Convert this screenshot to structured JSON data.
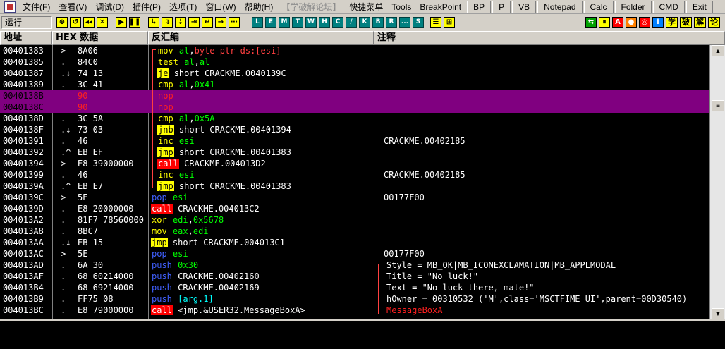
{
  "menu": {
    "items": [
      "文件(F)",
      "查看(V)",
      "调试(D)",
      "插件(P)",
      "选项(T)",
      "窗口(W)",
      "帮助(H)"
    ],
    "disabled_item": "【学破解论坛】",
    "quick_menu": "快捷菜单",
    "plain_items": [
      "Tools",
      "BreakPoint"
    ],
    "buttons": [
      "BP",
      "P",
      "VB",
      "Notepad",
      "Calc",
      "Folder",
      "CMD",
      "Exit"
    ]
  },
  "toolbar": {
    "status": "运行",
    "run_buttons": [
      "⊕",
      "↺",
      "◂◂",
      "✕",
      "▶",
      "❚❚",
      "↳",
      "↴",
      "⇣",
      "⇥",
      "↵",
      "→",
      "⋯"
    ],
    "letter_buttons": [
      "L",
      "E",
      "M",
      "T",
      "W",
      "H",
      "C",
      "/",
      "K",
      "B",
      "R",
      "...",
      "S"
    ],
    "right_buttons": [
      "☰",
      "⊞"
    ],
    "plugin_buttons": [
      "⇆",
      "⏸",
      "A",
      "●",
      "◎",
      "i"
    ],
    "cn_buttons": [
      "学",
      "破",
      "解",
      "论"
    ]
  },
  "headers": {
    "address": "地址",
    "hex": "HEX 数据",
    "disasm": "反汇编",
    "comment": "注释"
  },
  "rows": [
    {
      "addr": "00401383",
      "mark": ">",
      "hex": "8A06",
      "mn": "mov",
      "mk": "mov",
      "ops": [
        {
          "t": "al",
          "k": "reg"
        },
        {
          "t": ",",
          "k": "text"
        },
        {
          "t": "byte ptr ds:[esi]",
          "k": "mem"
        }
      ],
      "cmt": ""
    },
    {
      "addr": "00401385",
      "mark": ".",
      "hex": "84C0",
      "mn": "test",
      "mk": "test",
      "ops": [
        {
          "t": "al",
          "k": "reg"
        },
        {
          "t": ",",
          "k": "text"
        },
        {
          "t": "al",
          "k": "reg"
        }
      ],
      "cmt": ""
    },
    {
      "addr": "00401387",
      "mark": ".↓",
      "hex": "74 13",
      "mn": "je",
      "mk": "jcc",
      "ops": [
        {
          "t": "short CRACKME.0040139C",
          "k": "sym"
        }
      ],
      "cmt": ""
    },
    {
      "addr": "00401389",
      "mark": ".",
      "hex": "3C 41",
      "mn": "cmp",
      "mk": "cmp",
      "ops": [
        {
          "t": "al",
          "k": "reg"
        },
        {
          "t": ",",
          "k": "text"
        },
        {
          "t": "0x41",
          "k": "imm"
        }
      ],
      "cmt": ""
    },
    {
      "addr": "0040138B",
      "mark": "",
      "hex": "90",
      "mn": "nop",
      "mk": "nop",
      "ops": [],
      "cmt": "",
      "sel": true
    },
    {
      "addr": "0040138C",
      "mark": "",
      "hex": "90",
      "mn": "nop",
      "mk": "nop",
      "ops": [],
      "cmt": "",
      "sel": true
    },
    {
      "addr": "0040138D",
      "mark": ".",
      "hex": "3C 5A",
      "mn": "cmp",
      "mk": "cmp",
      "ops": [
        {
          "t": "al",
          "k": "reg"
        },
        {
          "t": ",",
          "k": "text"
        },
        {
          "t": "0x5A",
          "k": "imm"
        }
      ],
      "cmt": ""
    },
    {
      "addr": "0040138F",
      "mark": ".↓",
      "hex": "73 03",
      "mn": "jnb",
      "mk": "jcc",
      "ops": [
        {
          "t": "short CRACKME.00401394",
          "k": "sym"
        }
      ],
      "cmt": ""
    },
    {
      "addr": "00401391",
      "mark": ".",
      "hex": "46",
      "mn": "inc",
      "mk": "inc",
      "ops": [
        {
          "t": "esi",
          "k": "reg"
        }
      ],
      "cmt": "CRACKME.00402185"
    },
    {
      "addr": "00401392",
      "mark": ".^",
      "hex": "EB EF",
      "mn": "jmp",
      "mk": "jmp",
      "ops": [
        {
          "t": "short CRACKME.00401383",
          "k": "sym"
        }
      ],
      "cmt": ""
    },
    {
      "addr": "00401394",
      "mark": ">",
      "hex": "E8 39000000",
      "mn": "call",
      "mk": "call",
      "ops": [
        {
          "t": "CRACKME.004013D2",
          "k": "sym"
        }
      ],
      "cmt": ""
    },
    {
      "addr": "00401399",
      "mark": ".",
      "hex": "46",
      "mn": "inc",
      "mk": "inc",
      "ops": [
        {
          "t": "esi",
          "k": "reg"
        }
      ],
      "cmt": "CRACKME.00402185"
    },
    {
      "addr": "0040139A",
      "mark": ".^",
      "hex": "EB E7",
      "mn": "jmp",
      "mk": "jmp",
      "ops": [
        {
          "t": "short CRACKME.00401383",
          "k": "sym"
        }
      ],
      "cmt": ""
    },
    {
      "addr": "0040139C",
      "mark": ">",
      "hex": "5E",
      "mn": "pop",
      "mk": "pop",
      "ops": [
        {
          "t": "esi",
          "k": "reg"
        }
      ],
      "cmt": "00177F00"
    },
    {
      "addr": "0040139D",
      "mark": ".",
      "hex": "E8 20000000",
      "mn": "call",
      "mk": "call",
      "ops": [
        {
          "t": "CRACKME.004013C2",
          "k": "sym"
        }
      ],
      "cmt": ""
    },
    {
      "addr": "004013A2",
      "mark": ".",
      "hex": "81F7 78560000",
      "mn": "xor",
      "mk": "xor",
      "ops": [
        {
          "t": "edi",
          "k": "reg"
        },
        {
          "t": ",",
          "k": "text"
        },
        {
          "t": "0x5678",
          "k": "imm"
        }
      ],
      "cmt": ""
    },
    {
      "addr": "004013A8",
      "mark": ".",
      "hex": "8BC7",
      "mn": "mov",
      "mk": "mov",
      "ops": [
        {
          "t": "eax",
          "k": "reg"
        },
        {
          "t": ",",
          "k": "text"
        },
        {
          "t": "edi",
          "k": "reg"
        }
      ],
      "cmt": ""
    },
    {
      "addr": "004013AA",
      "mark": ".↓",
      "hex": "EB 15",
      "mn": "jmp",
      "mk": "jmp",
      "ops": [
        {
          "t": "short CRACKME.004013C1",
          "k": "sym"
        }
      ],
      "cmt": ""
    },
    {
      "addr": "004013AC",
      "mark": ">",
      "hex": "5E",
      "mn": "pop",
      "mk": "pop",
      "ops": [
        {
          "t": "esi",
          "k": "reg"
        }
      ],
      "cmt": "00177F00"
    },
    {
      "addr": "004013AD",
      "mark": ".",
      "hex": "6A 30",
      "mn": "push",
      "mk": "push",
      "ops": [
        {
          "t": "0x30",
          "k": "imm"
        }
      ],
      "cmt": "Style = MB_OK|MB_ICONEXCLAMATION|MB_APPLMODAL"
    },
    {
      "addr": "004013AF",
      "mark": ".",
      "hex": "68 60214000",
      "mn": "push",
      "mk": "push",
      "ops": [
        {
          "t": "CRACKME.00402160",
          "k": "sym"
        }
      ],
      "cmt": "Title = \"No luck!\""
    },
    {
      "addr": "004013B4",
      "mark": ".",
      "hex": "68 69214000",
      "mn": "push",
      "mk": "push",
      "ops": [
        {
          "t": "CRACKME.00402169",
          "k": "sym"
        }
      ],
      "cmt": "Text = \"No luck there, mate!\""
    },
    {
      "addr": "004013B9",
      "mark": ".",
      "hex": "FF75 08",
      "mn": "push",
      "mk": "push",
      "ops": [
        {
          "t": "[arg.1]",
          "k": "arg"
        }
      ],
      "cmt": "hOwner = 00310532 ('M',class='MSCTFIME UI',parent=00D30540)"
    },
    {
      "addr": "004013BC",
      "mark": ".",
      "hex": "E8 79000000",
      "mn": "call",
      "mk": "call",
      "ops": [
        {
          "t": "<jmp.&USER32.MessageBoxA>",
          "k": "sym"
        }
      ],
      "cmt": "MessageBoxA",
      "cmt_red": true
    }
  ]
}
